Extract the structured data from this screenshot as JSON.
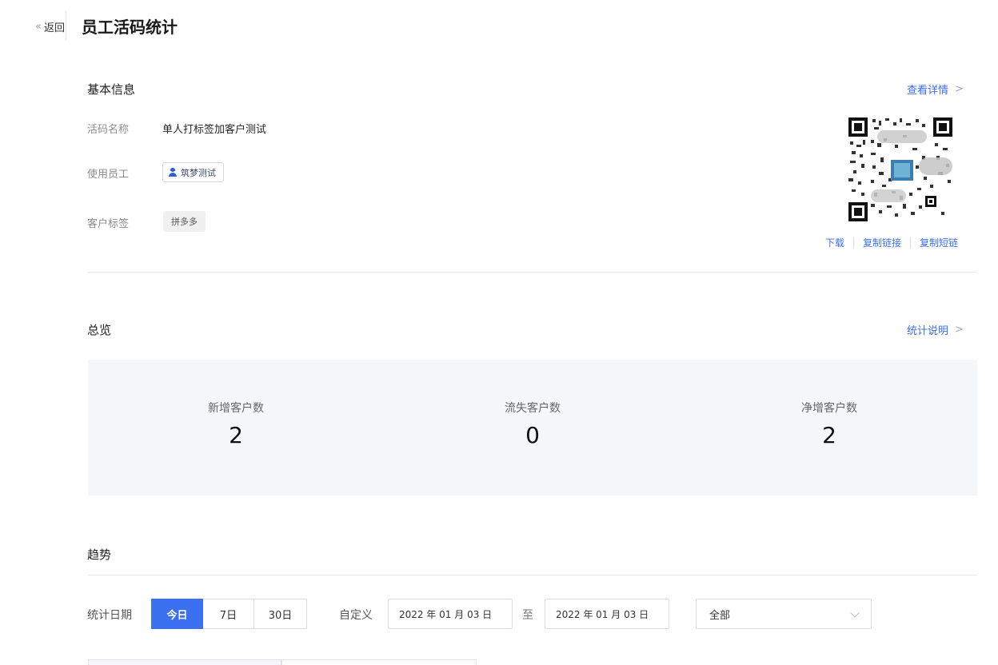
{
  "header": {
    "back_label": "返回",
    "title": "员工活码统计"
  },
  "basic_info": {
    "title": "基本信息",
    "detail_link": "查看详情",
    "fields": {
      "code_name": {
        "label": "活码名称",
        "value": "单人打标签加客户测试"
      },
      "staff": {
        "label": "使用员工",
        "value": "筑梦测试"
      },
      "customer_tag": {
        "label": "客户标签",
        "value": "拼多多"
      }
    },
    "qr_actions": [
      "下载",
      "复制链接",
      "复制短链"
    ]
  },
  "overview": {
    "title": "总览",
    "help_link": "统计说明",
    "stats": [
      {
        "label": "新增客户数",
        "value": "2"
      },
      {
        "label": "流失客户数",
        "value": "0"
      },
      {
        "label": "净增客户数",
        "value": "2"
      }
    ]
  },
  "trend": {
    "title": "趋势",
    "date_label": "统计日期",
    "ranges": [
      "今日",
      "7日",
      "30日"
    ],
    "active_range": "今日",
    "custom_label": "自定义",
    "start_date": "2022 年 01 月 03 日",
    "to_label": "至",
    "end_date": "2022 年 01 月 03 日",
    "scope_select": "全部"
  },
  "colors": {
    "accent": "#3a6ff0",
    "panel_bg": "#f5f6f8"
  }
}
